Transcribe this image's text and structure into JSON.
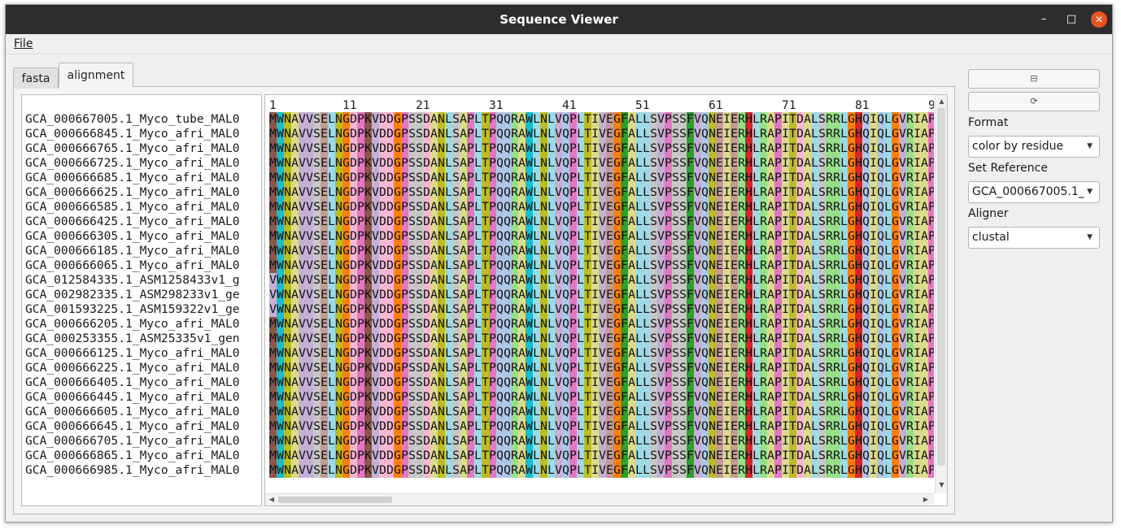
{
  "window": {
    "title": "Sequence Viewer"
  },
  "menu": {
    "file": "File"
  },
  "tabs": [
    {
      "label": "fasta",
      "active": false
    },
    {
      "label": "alignment",
      "active": true
    }
  ],
  "names": [
    "GCA_000667005.1_Myco_tube_MAL0",
    "GCA_000666845.1_Myco_afri_MAL0",
    "GCA_000666765.1_Myco_afri_MAL0",
    "GCA_000666725.1_Myco_afri_MAL0",
    "GCA_000666685.1_Myco_afri_MAL0",
    "GCA_000666625.1_Myco_afri_MAL0",
    "GCA_000666585.1_Myco_afri_MAL0",
    "GCA_000666425.1_Myco_afri_MAL0",
    "GCA_000666305.1_Myco_afri_MAL0",
    "GCA_000666185.1_Myco_afri_MAL0",
    "GCA_000666065.1_Myco_afri_MAL0",
    "GCA_012584335.1_ASM1258433v1_g",
    "GCA_002982335.1_ASM298233v1_ge",
    "GCA_001593225.1_ASM159322v1_ge",
    "GCA_000666205.1_Myco_afri_MAL0",
    "GCA_000253355.1_ASM25335v1_gen",
    "GCA_000666125.1_Myco_afri_MAL0",
    "GCA_000666225.1_Myco_afri_MAL0",
    "GCA_000666405.1_Myco_afri_MAL0",
    "GCA_000666445.1_Myco_afri_MAL0",
    "GCA_000666605.1_Myco_afri_MAL0",
    "GCA_000666645.1_Myco_afri_MAL0",
    "GCA_000666705.1_Myco_afri_MAL0",
    "GCA_000666865.1_Myco_afri_MAL0",
    "GCA_000666985.1_Myco_afri_MAL0"
  ],
  "ruler": [
    "1",
    "11",
    "21",
    "31",
    "41",
    "51",
    "61",
    "71",
    "81",
    "9"
  ],
  "sequences": [
    "MWNAVVSELNGDPKVDDGPSSDANLSAPLTPQQRAWLNLVQPLTIVEGFALLSVPSSFVQNEIERHLRAPITDALSRRLGHQIQLGVRIAP",
    "MWNAVVSELNGDPKVDDGPSSDANLSAPLTPQQRAWLNLVQPLTIVEGFALLSVPSSFVQNEIERHLRAPITDALSRRLGHQIQLGVRIAP",
    "MWNAVVSELNGDPKVDDGPSSDANLSAPLTPQQRAWLNLVQPLTIVEGFALLSVPSSFVQNEIERHLRAPITDALSRRLGHQIQLGVRIAP",
    "MWNAVVSELNGDPKVDDGPSSDANLSAPLTPQQRAWLNLVQPLTIVEGFALLSVPSSFVQNEIERHLRAPITDALSRRLGHQIQLGVRIAP",
    "MWNAVVSELNGDPKVDDGPSSDANLSAPLTPQQRAWLNLVQPLTIVEGFALLSVPSSFVQNEIERHLRAPITDALSRRLGHQIQLGVRIAP",
    "MWNAVVSELNGDPKVDDGPSSDANLSAPLTPQQRAWLNLVQPLTIVEGFALLSVPSSFVQNEIERHLRAPITDALSRRLGHQIQLGVRIAP",
    "MWNAVVSELNGDPKVDDGPSSDANLSAPLTPQQRAWLNLVQPLTIVEGFALLSVPSSFVQNEIERHLRAPITDALSRRLGHQIQLGVRIAP",
    "MWNAVVSELNGDPKVDDGPSSDANLSAPLTPQQRAWLNLVQPLTIVEGFALLSVPSSFVQNEIERHLRAPITDALSRRLGHQIQLGVRIAP",
    "MWNAVVSELNGDPKVDDGPSSDANLSAPLTPQQRAWLNLVQPLTIVEGFALLSVPSSFVQNEIERHLRAPITDALSRRLGHQIQLGVRIAP",
    "MWNAVVSELNGDPKVDDGPSSDANLSAPLTPQQRAWLNLVQPLTIVEGFALLSVPSSFVQNEIERHLRAPITDALSRRLGHQIQLGVRIAP",
    "MWNAVVSELNGDPKVDDGPSSDANLSAPLTPQQRAWLNLVQPLTIVEGFALLSVPSSFVQNEIERHLRAPITDALSRRLGHQIQLGVRIAP",
    "VWNAVVSELNGDPKVDDGPSSDANLSAPLTPQQRAWLNLVQPLTIVEGFALLSVPSSFVQNEIERHLRAPITDALSRRLGHQIQLGVRIAP",
    "VWNAVVSELNGDPKVDDGPSSDANLSAPLTPQQRAWLNLVQPLTIVEGFALLSVPSSFVQNEIERHLRAPITDALSRRLGHQIQLGVRIAP",
    "VWNAVVSELNGDPKVDDGPSSDANLSAPLTPQQRAWLNLVQPLTIVEGFALLSVPSSFVQNEIERHLRAPITDALSRRLGHQIQLGVRIAP",
    "MWNAVVSELNGDPKVDDGPSSDANLSAPLTPQQRAWLNLVQPLTIVEGFALLSVPSSFVQNEIERHLRAPITDALSRRLGHQIQLGVRIAP",
    "MWNAVVSELNGDPKVDDGPSSDANLSAPLTPQQRAWLNLVQPLTIVEGFALLSVPSSFVQNEIERHLRAPITDALSRRLGHQIQLGVRIAP",
    "MWNAVVSELNGDPKVDDGPSSDANLSAPLTPQQRAWLNLVQPLTIVEGFALLSVPSSFVQNEIERHLRAPITDALSRRLGHQIQLGVRIAP",
    "MWNAVVSELNGDPKVDDGPSSDANLSAPLTPQQRAWLNLVQPLTIVEGFALLSVPSSFVQNEIERHLRAPITDALSRRLGHQIQLGVRIAP",
    "MWNAVVSELNGDPKVDDGPSSDANLSAPLTPQQRAWLNLVQPLTIVEGFALLSVPSSFVQNEIERHLRAPITDALSRRLGHQIQLGVRIAP",
    "MWNAVVSELNGDPKVDDGPSSDANLSAPLTPQQRAWLNLVQPLTIVEGFALLSVPSSFVQNEIERHLRAPITDALSRRLGHQIQLGVRIAP",
    "MWNAVVSELNGDPKVDDGPSSDANLSAPLTPQQRAWLNLVQPLTIVEGFALLSVPSSFVQNEIERHLRAPITDALSRRLGHQIQLGVRIAP",
    "MWNAVVSELNGDPKVDDGPSSDANLSAPLTPQQRAWLNLVQPLTIVEGFALLSVPSSFVQNEIERHLRAPITDALSRRLGHQIQLGVRIAP",
    "MWNAVVSELNGDPKVDDGPSSDANLSAPLTPQQRAWLNLVQPLTIVEGFALLSVPSSFVQNEIERHLRAPITDALSRRLGHQIQLGVRIAP",
    "MWNAVVSELNGDPKVDDGPSSDANLSAPLTPQQRAWLNLVQPLTIVEGFALLSVPSSFVQNEIERHLRAPITDALSRRLGHQIQLGVRIAP",
    "MWNAVVSELNGDPKVDDGPSSDANLSAPLTPQQRAWLNLVQPLTIVEGFALLSVPSSFVQNEIERHLRAPITDALSRRLGHQIQLGVRIAP"
  ],
  "residue_colors": {
    "M": "#8c564b",
    "W": "#17becf",
    "N": "#bcbd22",
    "A": "#dbdb8d",
    "V": "#c5b0d5",
    "S": "#c7c7c7",
    "E": "#c49c94",
    "L": "#9edae5",
    "G": "#ff7f0e",
    "D": "#f7b6d2",
    "P": "#e377c2",
    "K": "#8c564b",
    "T": "#bcbd22",
    "Q": "#aec7e8",
    "R": "#98df8a",
    "I": "#dbdb8d",
    "F": "#2ca02c",
    "H": "#d62728",
    "Y": "#1f77b4",
    "C": "#ffbb78"
  },
  "sidebar": {
    "button_top_icon": "collapse-icon",
    "button_bottom_icon": "refresh-icon",
    "format_label": "Format",
    "format_value": "color by residue",
    "reference_label": "Set Reference",
    "reference_value": "GCA_000667005.1_Myco_tube_MAL0",
    "aligner_label": "Aligner",
    "aligner_value": "clustal"
  }
}
